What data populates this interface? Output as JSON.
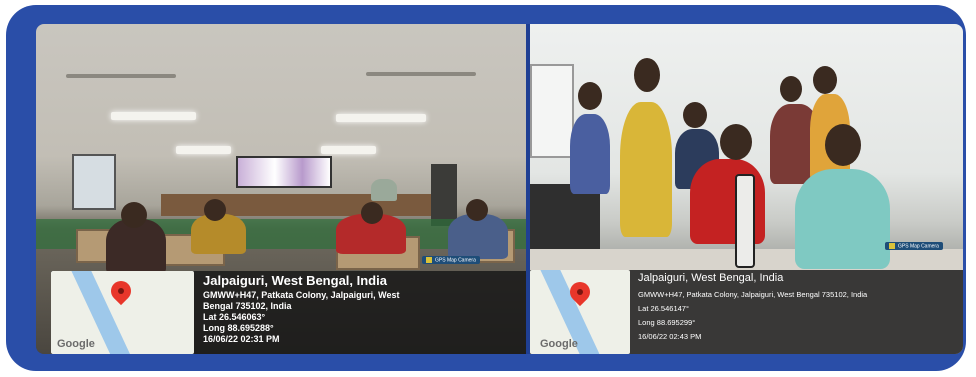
{
  "left_photo": {
    "camera_label": "GPS Map Camera",
    "map_brand": "Google",
    "location_title": "Jalpaiguri, West Bengal, India",
    "address_line1": "GMWW+H47, Patkata Colony, Jalpaiguri, West",
    "address_line2": "Bengal 735102, India",
    "lat": "Lat 26.546063°",
    "long": "Long 88.695288°",
    "timestamp": "16/06/22 02:31 PM"
  },
  "right_photo": {
    "camera_label": "GPS Map Camera",
    "map_brand": "Google",
    "location_title": "Jalpaiguri, West Bengal, India",
    "address": "GMWW+H47, Patkata Colony, Jalpaiguri, West Bengal 735102, India",
    "lat": "Lat 26.546147°",
    "long": "Long 88.695299°",
    "timestamp": "16/06/22 02:43 PM"
  },
  "colors": {
    "frame": "#2a4ea8",
    "pin": "#e8362a",
    "overlay": "#161616"
  },
  "icons": [
    "map-pin-icon",
    "gps-camera-icon"
  ]
}
